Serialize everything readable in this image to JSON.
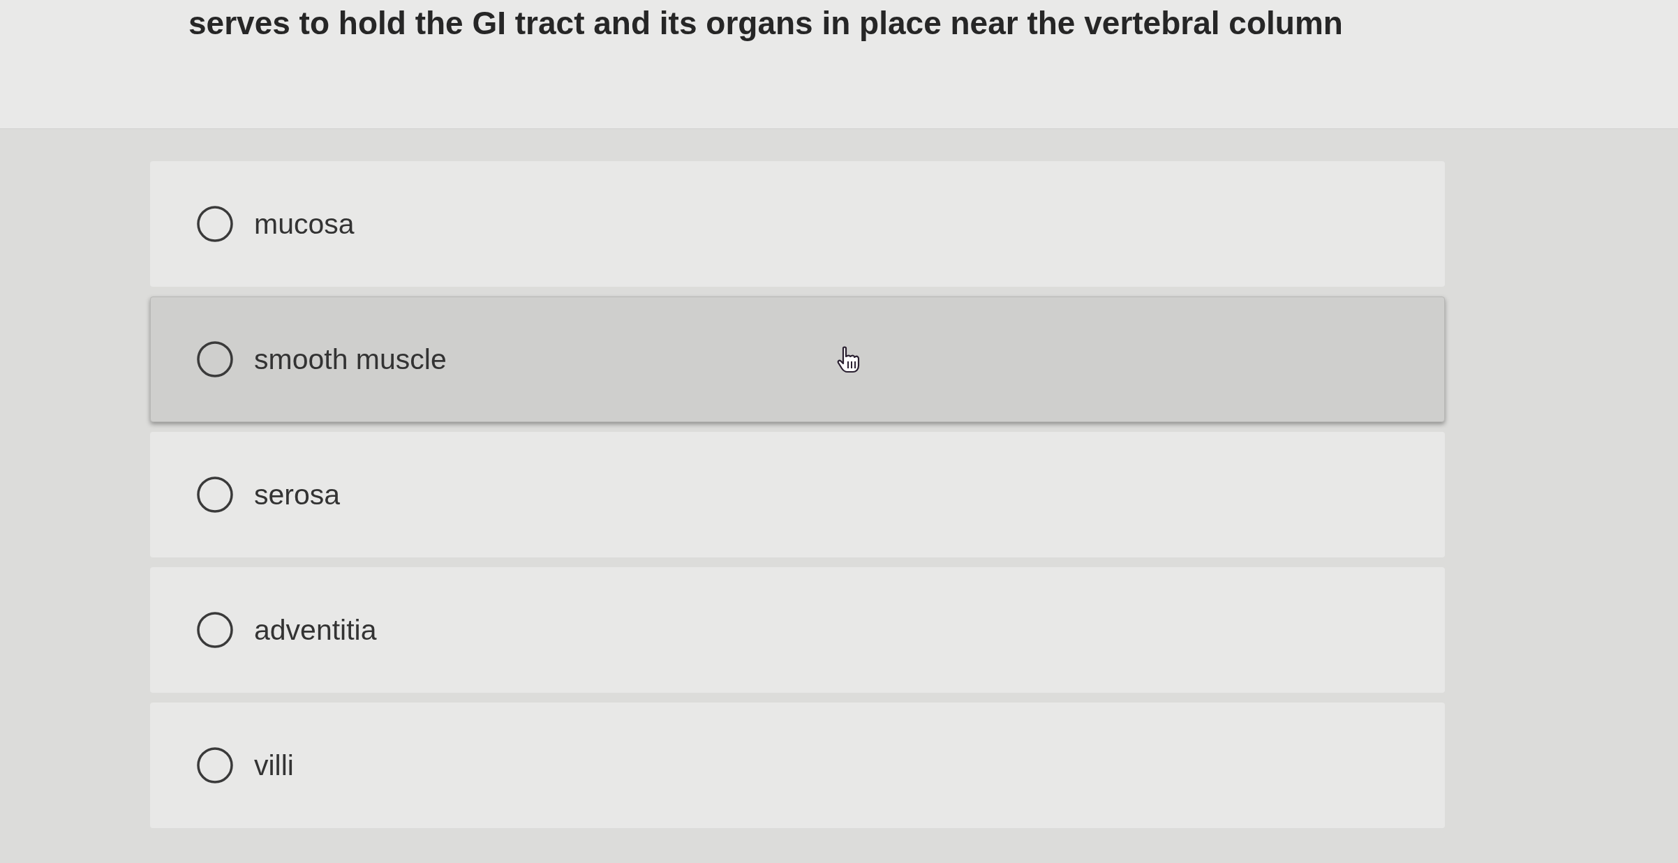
{
  "question": {
    "text": "serves to hold the GI tract and its organs in place near the vertebral column"
  },
  "options": [
    {
      "label": "mucosa",
      "selected": false,
      "hovered": false
    },
    {
      "label": "smooth muscle",
      "selected": false,
      "hovered": true
    },
    {
      "label": "serosa",
      "selected": false,
      "hovered": false
    },
    {
      "label": "adventitia",
      "selected": false,
      "hovered": false
    },
    {
      "label": "villi",
      "selected": false,
      "hovered": false
    }
  ]
}
